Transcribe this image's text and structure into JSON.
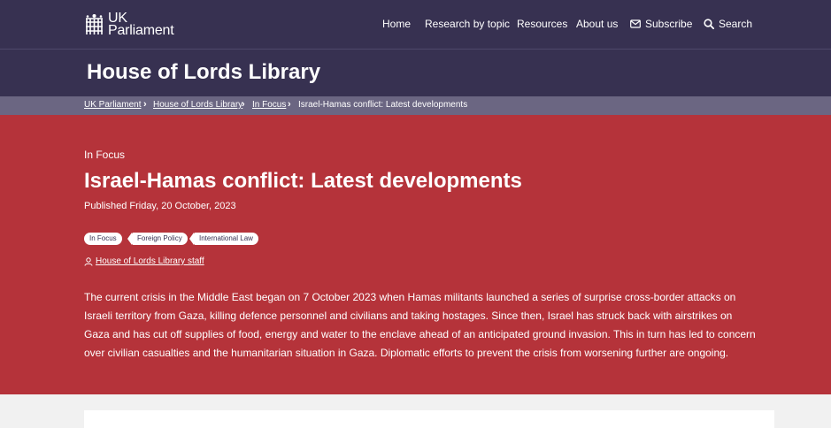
{
  "header": {
    "logo_line1": "UK",
    "logo_line2": "Parliament",
    "nav": [
      {
        "label": "Home"
      },
      {
        "label": "Research by topic"
      },
      {
        "label": "Resources"
      },
      {
        "label": "About us"
      },
      {
        "label": "Subscribe",
        "icon": "envelope-icon"
      },
      {
        "label": "Search",
        "icon": "search-icon"
      }
    ]
  },
  "section": {
    "title": "House of Lords Library"
  },
  "breadcrumb": [
    {
      "label": "UK Parliament"
    },
    {
      "label": "House of Lords Library"
    },
    {
      "label": "In Focus"
    },
    {
      "label": "Israel-Hamas conflict: Latest developments"
    }
  ],
  "article": {
    "kicker": "In Focus",
    "title": "Israel-Hamas conflict: Latest developments",
    "published": "Published Friday, 20 October, 2023",
    "tags": [
      {
        "label": "In Focus"
      },
      {
        "label": "Foreign Policy"
      },
      {
        "label": "International Law"
      }
    ],
    "author": "House of Lords Library staff",
    "summary": "The current crisis in the Middle East began on 7 October 2023 when Hamas militants launched a series of surprise cross-border attacks on Israeli territory from Gaza, killing defence personnel and civilians and taking hostages. Since then, Israel has struck back with airstrikes on Gaza and has cut off supplies of food, energy and water to the enclave ahead of an anticipated ground invasion. This in turn has led to concern over civilian casualties and the humanitarian situation in Gaza. Diplomatic efforts to prevent the crisis from worsening further are ongoing."
  },
  "colors": {
    "header_bg": "#373151",
    "breadcrumb_bg": "#6b6682",
    "hero_bg": "#b5333a"
  }
}
